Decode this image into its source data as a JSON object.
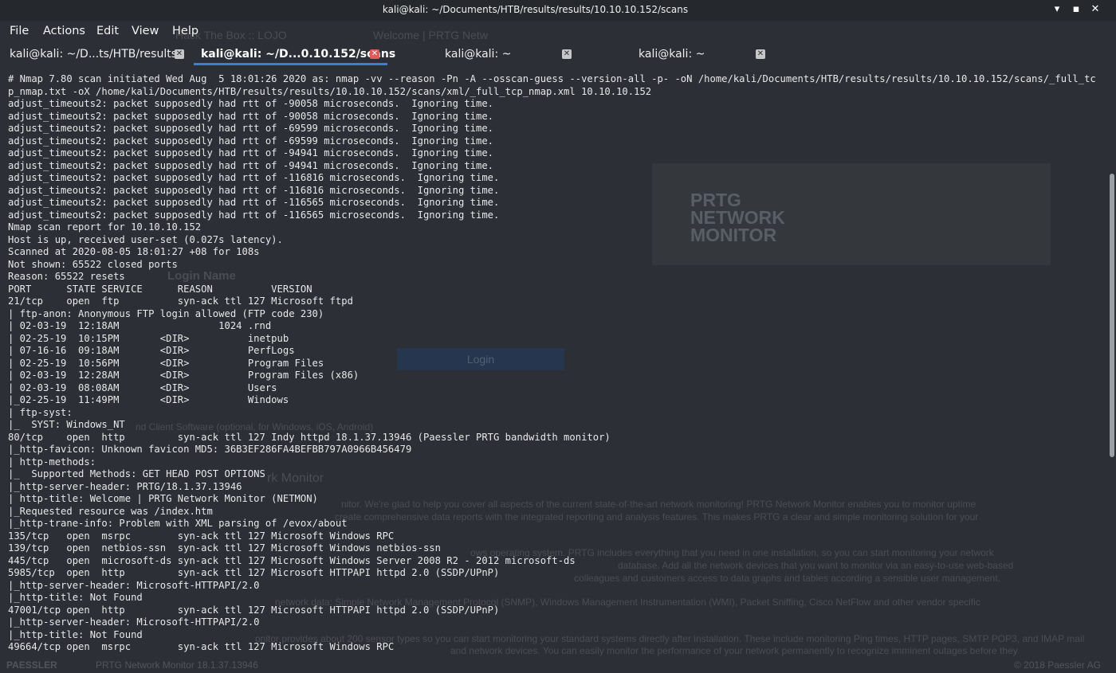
{
  "window": {
    "title": "kali@kali: ~/Documents/HTB/results/results/10.10.10.152/scans",
    "minimize_glyph": "▾",
    "maximize_glyph": "▪",
    "close_glyph": "✕"
  },
  "menu": [
    "File",
    "Actions",
    "Edit",
    "View",
    "Help"
  ],
  "tabs": [
    {
      "label": "kali@kali: ~/D...ts/HTB/results",
      "close_glyph": "✕"
    },
    {
      "label": "kali@kali: ~/D...0.10.152/scans",
      "close_glyph": "✕"
    },
    {
      "label": "kali@kali: ~",
      "close_glyph": "✕"
    },
    {
      "label": "kali@kali: ~",
      "close_glyph": "✕"
    }
  ],
  "background": {
    "browser_tabs": [
      "Hack The Box :: LOJO",
      "Welcome | PRTG Netw"
    ],
    "logo": [
      "PRTG",
      "NETWORK",
      "MONITOR"
    ],
    "login_name_label": "Login Name",
    "login_button": "Login",
    "client_software": "nd Client Software (optional, for Windows, iOS, Android)",
    "section_heading": "rk Monitor",
    "para1": "nitor. We're glad to help you cover all aspects of the current state-of-the-art network monitoring! PRTG Network Monitor enables you to monitor uptime",
    "para2": "create comprehensive data reports with the integrated reporting and analysis features. This makes PRTG a clear and simple monitoring solution for your",
    "para3": "ows operating system. PRTG includes everything that you need in one installation, so you can start monitoring your network",
    "para4": "database. Add all the network devices that you want to monitor via an easy-to-use web-based",
    "para5": "colleagues and customers access to data graphs and tables according a sensible user management.",
    "para6": "network data: Simple Network Management Protocol (SNMP), Windows Management Instrumentation (WMI), Packet Sniffing, Cisco NetFlow and other vendor specific",
    "para7": "onitor provides about 200 sensor types so you can start monitoring your standard systems directly after installation. These include monitoring Ping times, HTTP pages, SMTP POP3, and IMAP mail",
    "para8": "and network devices. You can easily monitor the performance of your network permanently to recognize imminent outages before they",
    "footer_brand": "PAESSLER",
    "footer_version": "PRTG Network Monitor 18.1.37.13946",
    "footer_copyright": "© 2018 Paessler AG"
  },
  "terminal_output": [
    "# Nmap 7.80 scan initiated Wed Aug  5 18:01:26 2020 as: nmap -vv --reason -Pn -A --osscan-guess --version-all -p- -oN /home/kali/Documents/HTB/results/results/10.10.10.152/scans/_full_tcp_nmap.txt -oX /home/kali/Documents/HTB/results/results/10.10.10.152/scans/xml/_full_tcp_nmap.xml 10.10.10.152",
    "adjust_timeouts2: packet supposedly had rtt of -90058 microseconds.  Ignoring time.",
    "adjust_timeouts2: packet supposedly had rtt of -90058 microseconds.  Ignoring time.",
    "adjust_timeouts2: packet supposedly had rtt of -69599 microseconds.  Ignoring time.",
    "adjust_timeouts2: packet supposedly had rtt of -69599 microseconds.  Ignoring time.",
    "adjust_timeouts2: packet supposedly had rtt of -94941 microseconds.  Ignoring time.",
    "adjust_timeouts2: packet supposedly had rtt of -94941 microseconds.  Ignoring time.",
    "adjust_timeouts2: packet supposedly had rtt of -116816 microseconds.  Ignoring time.",
    "adjust_timeouts2: packet supposedly had rtt of -116816 microseconds.  Ignoring time.",
    "adjust_timeouts2: packet supposedly had rtt of -116565 microseconds.  Ignoring time.",
    "adjust_timeouts2: packet supposedly had rtt of -116565 microseconds.  Ignoring time.",
    "Nmap scan report for 10.10.10.152",
    "Host is up, received user-set (0.027s latency).",
    "Scanned at 2020-08-05 18:01:27 +08 for 108s",
    "Not shown: 65522 closed ports",
    "Reason: 65522 resets",
    "PORT      STATE SERVICE      REASON          VERSION",
    "21/tcp    open  ftp          syn-ack ttl 127 Microsoft ftpd",
    "| ftp-anon: Anonymous FTP login allowed (FTP code 230)",
    "| 02-03-19  12:18AM                 1024 .rnd",
    "| 02-25-19  10:15PM       <DIR>          inetpub",
    "| 07-16-16  09:18AM       <DIR>          PerfLogs",
    "| 02-25-19  10:56PM       <DIR>          Program Files",
    "| 02-03-19  12:28AM       <DIR>          Program Files (x86)",
    "| 02-03-19  08:08AM       <DIR>          Users",
    "|_02-25-19  11:49PM       <DIR>          Windows",
    "| ftp-syst:",
    "|_  SYST: Windows_NT",
    "80/tcp    open  http         syn-ack ttl 127 Indy httpd 18.1.37.13946 (Paessler PRTG bandwidth monitor)",
    "|_http-favicon: Unknown favicon MD5: 36B3EF286FA4BEFBB797A0966B456479",
    "| http-methods:",
    "|_  Supported Methods: GET HEAD POST OPTIONS",
    "|_http-server-header: PRTG/18.1.37.13946",
    "| http-title: Welcome | PRTG Network Monitor (NETMON)",
    "|_Requested resource was /index.htm",
    "|_http-trane-info: Problem with XML parsing of /evox/about",
    "135/tcp   open  msrpc        syn-ack ttl 127 Microsoft Windows RPC",
    "139/tcp   open  netbios-ssn  syn-ack ttl 127 Microsoft Windows netbios-ssn",
    "445/tcp   open  microsoft-ds syn-ack ttl 127 Microsoft Windows Server 2008 R2 - 2012 microsoft-ds",
    "5985/tcp  open  http         syn-ack ttl 127 Microsoft HTTPAPI httpd 2.0 (SSDP/UPnP)",
    "|_http-server-header: Microsoft-HTTPAPI/2.0",
    "|_http-title: Not Found",
    "47001/tcp open  http         syn-ack ttl 127 Microsoft HTTPAPI httpd 2.0 (SSDP/UPnP)",
    "|_http-server-header: Microsoft-HTTPAPI/2.0",
    "|_http-title: Not Found",
    "49664/tcp open  msrpc        syn-ack ttl 127 Microsoft Windows RPC"
  ]
}
